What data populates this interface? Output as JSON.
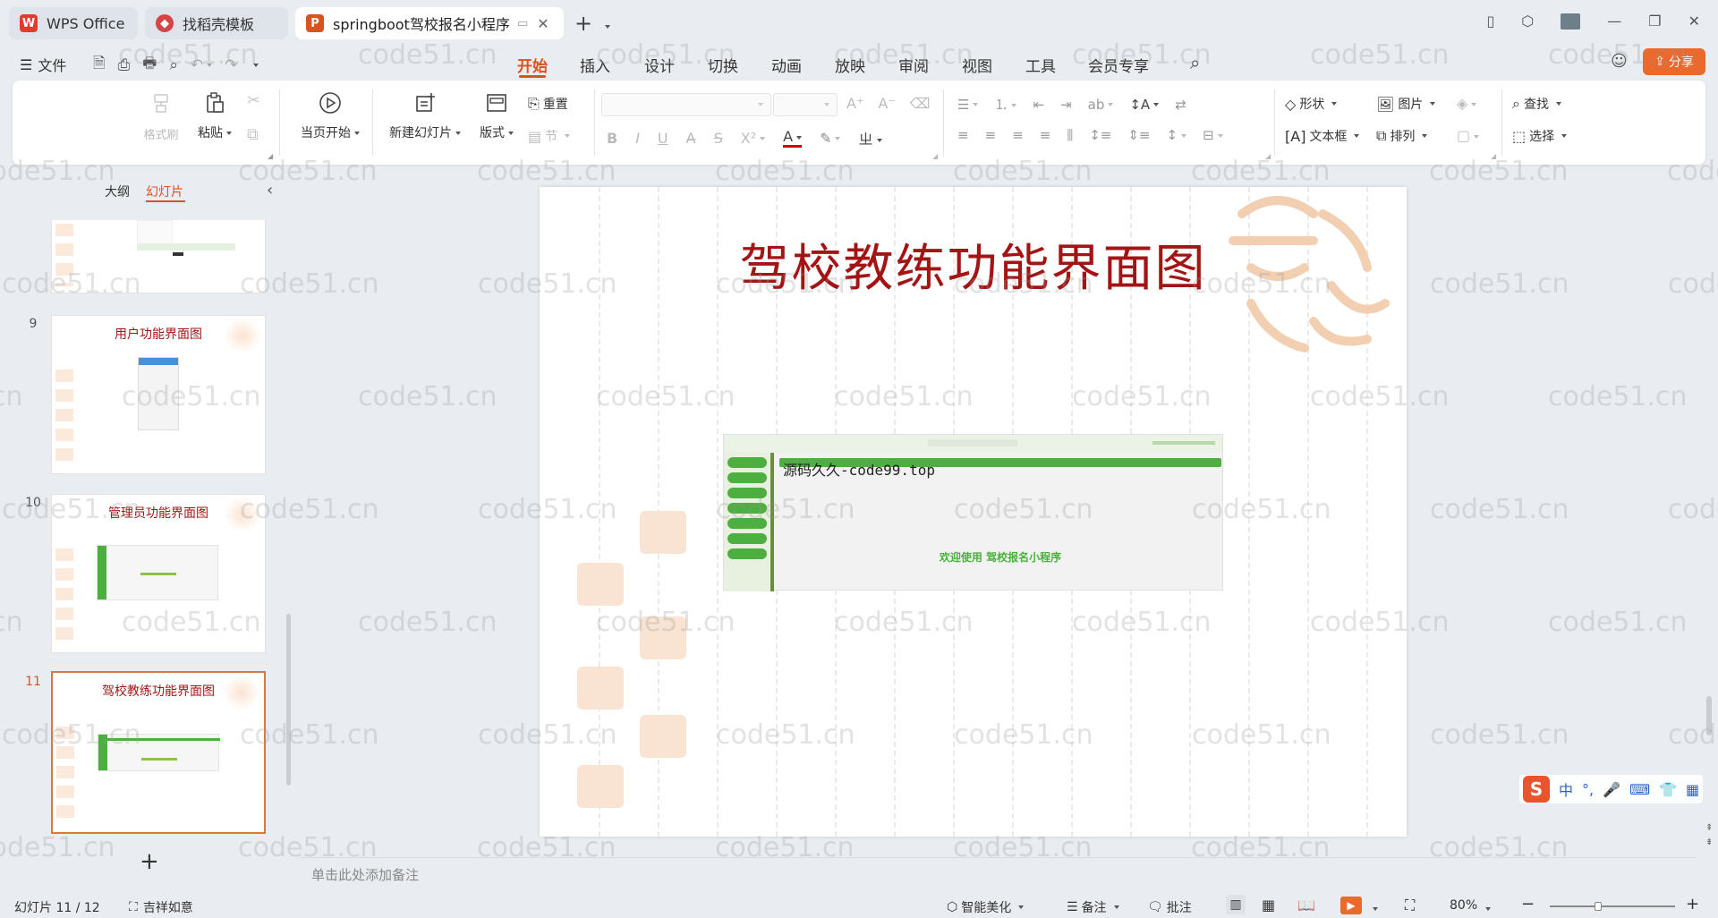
{
  "tabs": [
    {
      "label": "WPS Office"
    },
    {
      "label": "找稻壳模板"
    },
    {
      "label": "springboot驾校报名小程序 P"
    }
  ],
  "menu": {
    "file_label": "文件",
    "items": [
      "开始",
      "插入",
      "设计",
      "切换",
      "动画",
      "放映",
      "审阅",
      "视图",
      "工具",
      "会员专享"
    ],
    "share_label": "分享"
  },
  "ribbon": {
    "format_brush": "格式刷",
    "paste": "粘贴",
    "play_from_current": "当页开始",
    "new_slide": "新建幻灯片",
    "layout": "版式",
    "reset": "重置",
    "section": "节",
    "shape": "形状",
    "picture": "图片",
    "find": "查找",
    "textbox": "文本框",
    "arrange": "排列",
    "select": "选择"
  },
  "left_panel": {
    "outline_tab": "大纲",
    "slides_tab": "幻灯片",
    "slides": [
      {
        "number": "9",
        "title": "用户功能界面图"
      },
      {
        "number": "10",
        "title": "管理员功能界面图"
      },
      {
        "number": "11",
        "title": "驾校教练功能界面图"
      }
    ]
  },
  "slide": {
    "title": "驾校教练功能界面图",
    "screenshot_overlay": "源码久久-code99.top",
    "screenshot_welcome": "欢迎使用 驾校报名小程序"
  },
  "notes_placeholder": "单击此处添加备注",
  "ime": {
    "lang": "中",
    "punct": "°,"
  },
  "status": {
    "slide_counter": "幻灯片 11 / 12",
    "theme": "吉祥如意",
    "beautify": "智能美化",
    "notes": "备注",
    "comments": "批注",
    "zoom": "80%"
  },
  "watermark_text": "code51.cn",
  "colors": {
    "accent": "#d9531e",
    "slide_title": "#a31515",
    "green": "#4caf3f"
  }
}
